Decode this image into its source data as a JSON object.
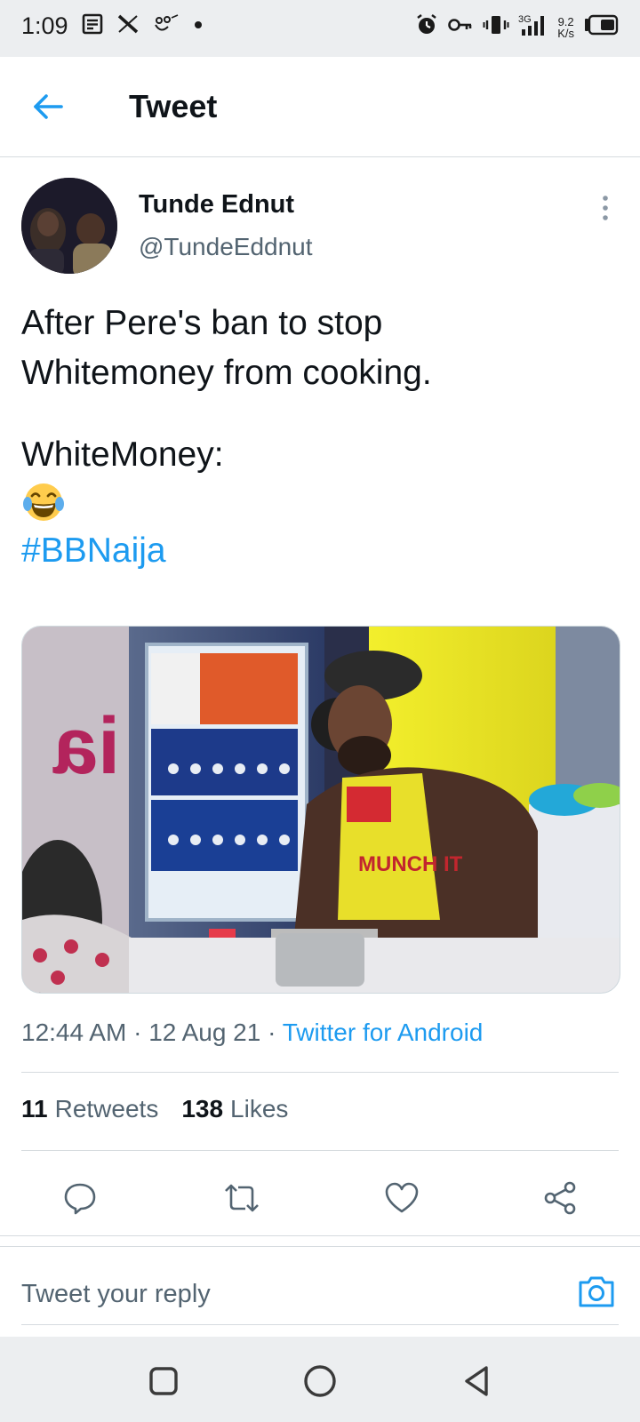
{
  "status_bar": {
    "time": "1:09",
    "speed_value": "9.2",
    "speed_unit": "K/s",
    "icons": [
      "document-icon",
      "x-logo-icon",
      "app-notification-icon",
      "dot-icon",
      "alarm-icon",
      "vpn-key-icon",
      "vibrate-icon",
      "signal-icon",
      "battery-icon"
    ]
  },
  "header": {
    "title": "Tweet",
    "back_icon": "arrow-left-icon"
  },
  "tweet": {
    "author": {
      "name": "Tunde Ednut",
      "handle": "@TundeEddnut"
    },
    "text_lines": [
      "After Pere's ban to stop",
      "Whitemoney from cooking."
    ],
    "text_line_3": "WhiteMoney:",
    "emoji": "😂",
    "hashtag": "#BBNaija",
    "meta": {
      "time": "12:44 AM",
      "sep": "·",
      "date": "12 Aug 21",
      "source": "Twitter for Android"
    },
    "stats": {
      "retweets_count": "11",
      "retweets_label": "Retweets",
      "likes_count": "138",
      "likes_label": "Likes"
    },
    "media": {
      "overlay_apron_text": "MUNCH IT",
      "overlay_wall_text": "ia"
    }
  },
  "actions": [
    "reply-icon",
    "retweet-icon",
    "like-icon",
    "share-icon"
  ],
  "reply": {
    "placeholder": "Tweet your reply",
    "camera_icon": "camera-icon"
  },
  "nav_bar": [
    "recents-square-icon",
    "home-circle-icon",
    "back-triangle-icon"
  ],
  "colors": {
    "accent": "#1d9bf0",
    "text_primary": "#0f1419",
    "text_secondary": "#536471",
    "divider": "#d6dbdf",
    "system_bar": "#eceef0"
  }
}
